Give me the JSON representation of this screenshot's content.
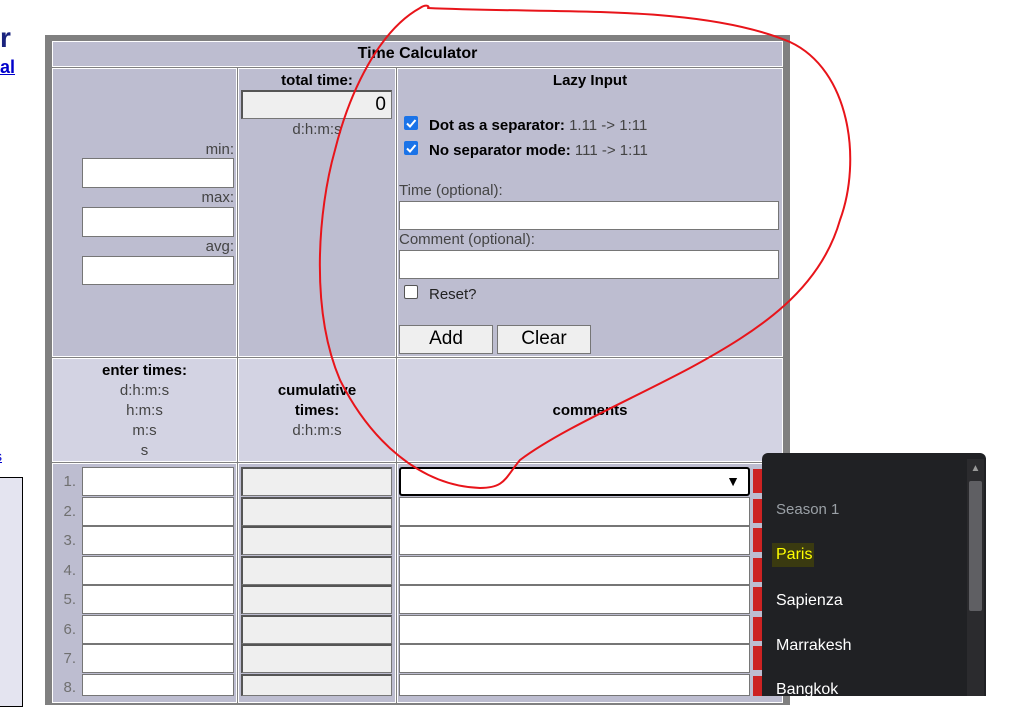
{
  "left_partial": {
    "title_fragment": "r",
    "link_fragment": "al",
    "link_fragment_2": "s"
  },
  "calculator": {
    "title": "Time Calculator",
    "min_label": "min:",
    "max_label": "max:",
    "avg_label": "avg:",
    "total_time_label": "total time:",
    "total_time_value": "0",
    "total_time_format": "d:h:m:s",
    "lazy_input_title": "Lazy Input",
    "dot_separator_label": "Dot as a separator:",
    "dot_separator_example": "1.11 -> 1:11",
    "dot_separator_checked": true,
    "no_separator_label": "No separator mode:",
    "no_separator_example": "111 -> 1:11",
    "no_separator_checked": true,
    "time_optional_label": "Time (optional):",
    "comment_optional_label": "Comment (optional):",
    "reset_label": "Reset?",
    "reset_checked": false,
    "add_button": "Add",
    "clear_button": "Clear",
    "enter_times_title": "enter times:",
    "enter_times_formats": [
      "d:h:m:s",
      "h:m:s",
      "m:s",
      "s"
    ],
    "cumulative_title_1": "cumulative",
    "cumulative_title_2": "times:",
    "cumulative_format": "d:h:m:s",
    "comments_title": "comments",
    "row_numbers": [
      "1.",
      "2.",
      "3.",
      "4.",
      "5.",
      "6.",
      "7.",
      "8."
    ]
  },
  "dropdown": {
    "group_label": "Season 1",
    "options": [
      "Paris",
      "Sapienza",
      "Marrakesh",
      "Bangkok"
    ],
    "highlighted": "Paris"
  },
  "colors": {
    "annotation": "#e8141a",
    "highlight": "#ffff00",
    "dropdown_bg": "#202124",
    "cell_bg": "#bdbdd0",
    "link": "#0000cc",
    "delete_button": "#cc2222"
  }
}
